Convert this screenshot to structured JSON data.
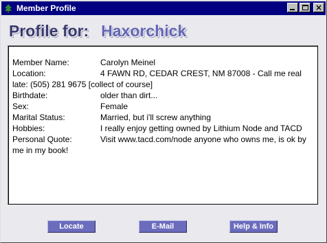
{
  "window": {
    "title": "Member Profile",
    "controls": {
      "minimize": "minimize",
      "maximize": "maximize",
      "close": "×"
    }
  },
  "header": {
    "label": "Profile for:",
    "screen_name": "Haxorchick"
  },
  "profile": [
    {
      "label": "Member Name:",
      "value": "Carolyn Meinel"
    },
    {
      "label": "Location:",
      "value": "4 FAWN RD, CEDAR CREST,  NM   87008 - Call me real late: (505) 281 9675  [collect of course]"
    },
    {
      "label": "Birthdate:",
      "value": "older than dirt..."
    },
    {
      "label": "Sex:",
      "value": "Female"
    },
    {
      "label": "Marital Status:",
      "value": "Married, but i'll screw anything"
    },
    {
      "label": "Hobbies:",
      "value": "I really enjoy getting owned by Lithium Node and TACD"
    },
    {
      "label": "Personal Quote:",
      "value": "Visit www.tacd.com/node    anyone who owns me, is ok by me in my book!"
    }
  ],
  "buttons": {
    "locate": "Locate",
    "email": "E-Mail",
    "help": "Help & Info"
  },
  "colors": {
    "titlebar": "#000080",
    "header_label": "#3a3a6e",
    "header_name": "#6466b5",
    "button_face": "#6c6cbd",
    "window_bg": "#e9e9ee"
  },
  "icons": {
    "app": "tree-icon"
  }
}
